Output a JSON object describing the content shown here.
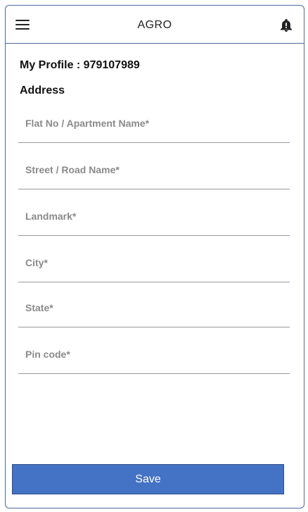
{
  "appbar": {
    "title": "AGRO",
    "menu_icon": "hamburger-menu-icon",
    "notification_icon": "bell-icon"
  },
  "profile": {
    "heading": "My Profile : 979107989"
  },
  "address": {
    "heading": "Address",
    "fields": [
      {
        "placeholder": "Flat No / Apartment Name*",
        "value": ""
      },
      {
        "placeholder": "Street / Road Name*",
        "value": ""
      },
      {
        "placeholder": "Landmark*",
        "value": ""
      },
      {
        "placeholder": "City*",
        "value": ""
      },
      {
        "placeholder": "State*",
        "value": ""
      },
      {
        "placeholder": "Pin code*",
        "value": ""
      }
    ]
  },
  "actions": {
    "save_label": "Save"
  },
  "colors": {
    "accent": "#4472c4",
    "border": "#4b6a9b",
    "placeholder": "#8a8a8a"
  }
}
